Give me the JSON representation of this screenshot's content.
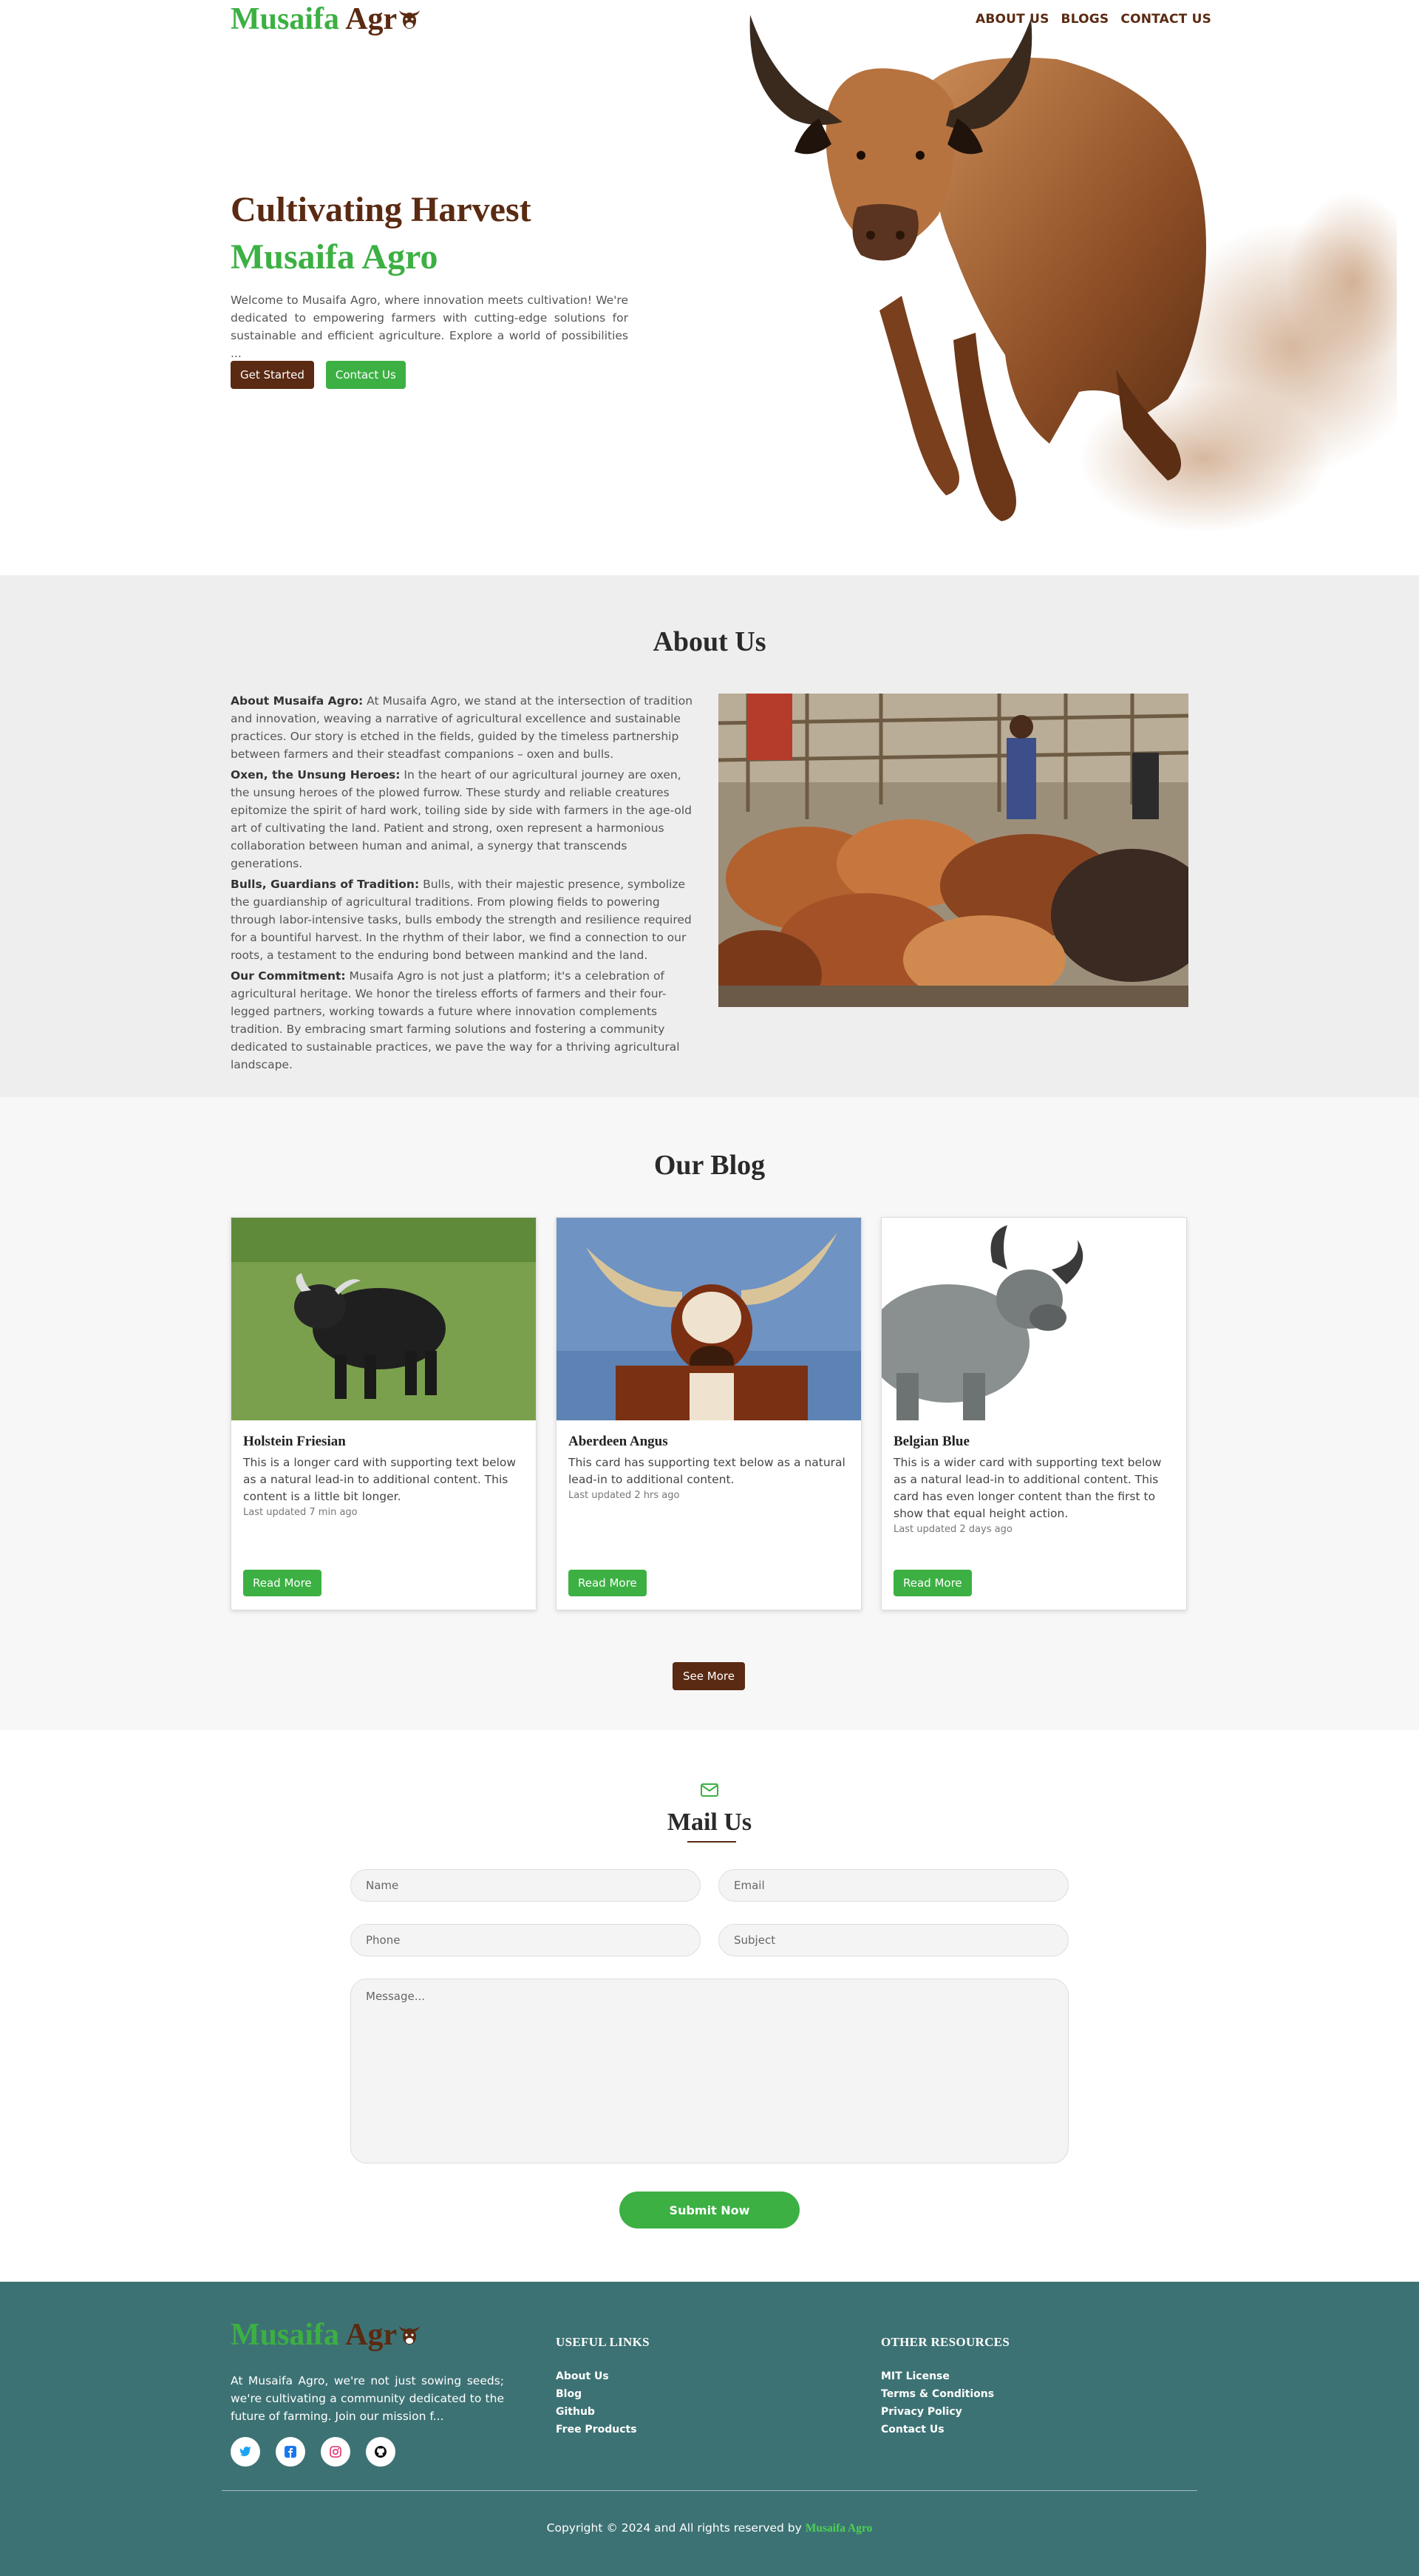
{
  "brand": {
    "name_green": "Musaifa",
    "name_brown": "Agr",
    "accent_green": "#3cb043",
    "accent_brown": "#5a2a12"
  },
  "nav": {
    "items": [
      "ABOUT US",
      "BLOGS",
      "CONTACT US"
    ]
  },
  "hero": {
    "title_line1": "Cultivating Harvest",
    "title_line2": "Musaifa Agro",
    "text": "Welcome to Musaifa Agro, where innovation meets cultivation! We're dedicated to empowering farmers with cutting-edge solutions for sustainable and efficient agriculture. Explore a world of possibilities ...",
    "btn_primary": "Get Started",
    "btn_secondary": "Contact Us"
  },
  "about": {
    "title": "About Us",
    "paragraphs": [
      {
        "lead": "About Musaifa Agro:",
        "text": " At Musaifa Agro, we stand at the intersection of tradition and innovation, weaving a narrative of agricultural excellence and sustainable practices. Our story is etched in the fields, guided by the timeless partnership between farmers and their steadfast companions – oxen and bulls."
      },
      {
        "lead": "Oxen, the Unsung Heroes:",
        "text": " In the heart of our agricultural journey are oxen, the unsung heroes of the plowed furrow. These sturdy and reliable creatures epitomize the spirit of hard work, toiling side by side with farmers in the age-old art of cultivating the land. Patient and strong, oxen represent a harmonious collaboration between human and animal, a synergy that transcends generations."
      },
      {
        "lead": "Bulls, Guardians of Tradition:",
        "text": " Bulls, with their majestic presence, symbolize the guardianship of agricultural traditions. From plowing fields to powering through labor-intensive tasks, bulls embody the strength and resilience required for a bountiful harvest. In the rhythm of their labor, we find a connection to our roots, a testament to the enduring bond between mankind and the land."
      },
      {
        "lead": "Our Commitment:",
        "text": " Musaifa Agro is not just a platform; it's a celebration of agricultural heritage. We honor the tireless efforts of farmers and their four-legged partners, working towards a future where innovation complements tradition. By embracing smart farming solutions and fostering a community dedicated to sustainable practices, we pave the way for a thriving agricultural landscape."
      }
    ]
  },
  "blog": {
    "title": "Our Blog",
    "cards": [
      {
        "title": "Holstein Friesian",
        "text": "This is a longer card with supporting text below as a natural lead-in to additional content. This content is a little bit longer.",
        "meta": "Last updated 7 min ago",
        "button": "Read More"
      },
      {
        "title": "Aberdeen Angus",
        "text": "This card has supporting text below as a natural lead-in to additional content.",
        "meta": "Last updated 2 hrs ago",
        "button": "Read More"
      },
      {
        "title": "Belgian Blue",
        "text": "This is a wider card with supporting text below as a natural lead-in to additional content. This card has even longer content than the first to show that equal height action.",
        "meta": "Last updated 2 days ago",
        "button": "Read More"
      }
    ],
    "see_more": "See More"
  },
  "mail": {
    "title": "Mail Us",
    "placeholders": {
      "name": "Name",
      "email": "Email",
      "phone": "Phone",
      "subject": "Subject",
      "message": "Message..."
    },
    "submit": "Submit Now"
  },
  "footer": {
    "about": "At Musaifa Agro, we're not just sowing seeds; we're cultivating a community dedicated to the future of farming. Join our mission f...",
    "socials": [
      "twitter-icon",
      "facebook-icon",
      "instagram-icon",
      "github-icon"
    ],
    "useful_links_title": "USEFUL LINKS",
    "useful_links": [
      "About Us",
      "Blog",
      "Github",
      "Free Products"
    ],
    "other_resources_title": "OTHER RESOURCES",
    "other_resources": [
      "MIT License",
      "Terms & Conditions",
      "Privacy Policy",
      "Contact Us"
    ],
    "copyright_prefix": "Copyright © 2024 and All rights reserved by ",
    "copyright_brand": "Musaifa Agro",
    "bg_color": "#3d7274"
  }
}
